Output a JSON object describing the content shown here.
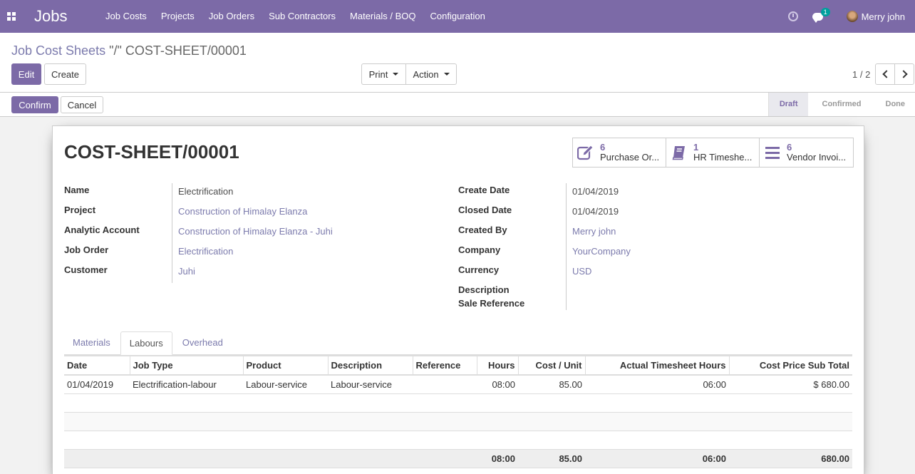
{
  "navbar": {
    "app_name": "Jobs",
    "menu": [
      "Job Costs",
      "Projects",
      "Job Orders",
      "Sub Contractors",
      "Materials / BOQ",
      "Configuration"
    ],
    "chat_count": "1",
    "user_name": "Merry john"
  },
  "breadcrumb": {
    "parent": "Job Cost Sheets",
    "separator": " \"/\" ",
    "current": "COST-SHEET/00001"
  },
  "buttons": {
    "edit": "Edit",
    "create": "Create",
    "print": "Print",
    "action": "Action"
  },
  "pager": {
    "value": "1 / 2"
  },
  "statusbar": {
    "confirm": "Confirm",
    "cancel": "Cancel",
    "stages": [
      "Draft",
      "Confirmed",
      "Done"
    ],
    "active_stage": "Draft"
  },
  "sheet": {
    "title": "COST-SHEET/00001",
    "smart_buttons": [
      {
        "count": "6",
        "label": "Purchase Or...",
        "icon": "edit-icon"
      },
      {
        "count": "1",
        "label": "HR Timeshe...",
        "icon": "book-icon"
      },
      {
        "count": "6",
        "label": "Vendor Invoi...",
        "icon": "list-icon"
      }
    ],
    "left_fields": [
      {
        "label": "Name",
        "value": "Electrification",
        "link": false
      },
      {
        "label": "Project",
        "value": "Construction of Himalay Elanza",
        "link": true
      },
      {
        "label": "Analytic Account",
        "value": "Construction of Himalay Elanza - Juhi",
        "link": true
      },
      {
        "label": "Job Order",
        "value": "Electrification",
        "link": true
      },
      {
        "label": "Customer",
        "value": "Juhi",
        "link": true
      }
    ],
    "right_fields": [
      {
        "label": "Create Date",
        "value": "01/04/2019",
        "link": false
      },
      {
        "label": "Closed Date",
        "value": "01/04/2019",
        "link": false
      },
      {
        "label": "Created By",
        "value": "Merry john",
        "link": true
      },
      {
        "label": "Company",
        "value": "YourCompany",
        "link": true
      },
      {
        "label": "Currency",
        "value": "USD",
        "link": true
      },
      {
        "label": "Description",
        "value": "",
        "link": false
      },
      {
        "label": "Sale Reference",
        "value": "",
        "link": false
      }
    ],
    "tabs": [
      "Materials",
      "Labours",
      "Overhead"
    ],
    "active_tab": "Labours",
    "table": {
      "headers": [
        "Date",
        "Job Type",
        "Product",
        "Description",
        "Reference",
        "Hours",
        "Cost / Unit",
        "Actual Timesheet Hours",
        "Cost Price Sub Total"
      ],
      "rows": [
        [
          "01/04/2019",
          "Electrification-labour",
          "Labour-service",
          "Labour-service",
          "",
          "08:00",
          "85.00",
          "06:00",
          "$ 680.00"
        ]
      ],
      "totals": [
        "",
        "",
        "",
        "",
        "",
        "08:00",
        "85.00",
        "06:00",
        "680.00"
      ]
    }
  },
  "colors": {
    "brand": "#7c6aa7",
    "link": "#7c7bad"
  }
}
